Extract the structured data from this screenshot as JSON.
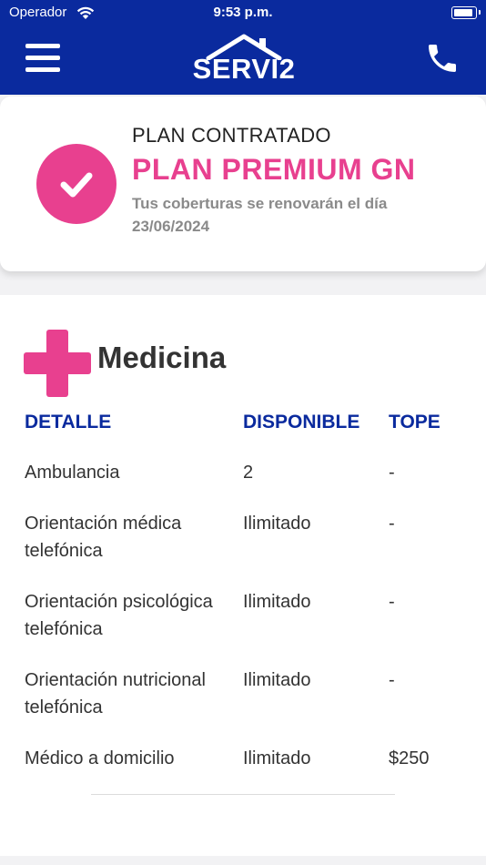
{
  "status_bar": {
    "carrier": "Operador",
    "time": "9:53 p.m."
  },
  "header": {
    "logo_text": "SERVI2"
  },
  "plan": {
    "label": "PLAN CONTRATADO",
    "name": "PLAN PREMIUM GN",
    "renewal_line1": "Tus coberturas se renovarán el día",
    "renewal_line2": "23/06/2024"
  },
  "section": {
    "title": "Medicina",
    "columns": [
      "DETALLE",
      "DISPONIBLE",
      "TOPE"
    ],
    "rows": [
      {
        "detail_line1": "Ambulancia",
        "detail_line2": "",
        "available": "2",
        "cap": "-"
      },
      {
        "detail_line1": "Orientación médica",
        "detail_line2": "telefónica",
        "available": "Ilimitado",
        "cap": "-"
      },
      {
        "detail_line1": "Orientación psicológica",
        "detail_line2": "telefónica",
        "available": "Ilimitado",
        "cap": "-"
      },
      {
        "detail_line1": "Orientación nutricional",
        "detail_line2": "telefónica",
        "available": "Ilimitado",
        "cap": "-"
      },
      {
        "detail_line1": "Médico a domicilio",
        "detail_line2": "",
        "available": "Ilimitado",
        "cap": "$250"
      }
    ]
  },
  "colors": {
    "brand_blue": "#0a2a9e",
    "accent_pink": "#e8408f"
  },
  "icons": [
    "wifi-icon",
    "battery-icon",
    "menu-icon",
    "house-roof-icon",
    "phone-icon",
    "check-icon",
    "medical-cross-icon"
  ]
}
